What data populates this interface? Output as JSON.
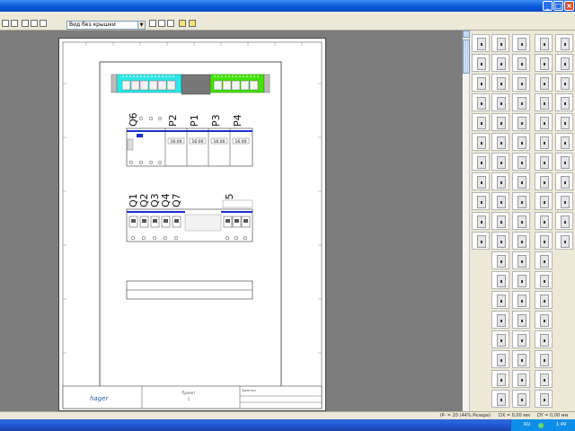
{
  "toolbar": {
    "view_select_value": "Вид без крышки"
  },
  "drawing": {
    "row1_labels": [
      "Q6",
      "P2",
      "P1",
      "P3",
      "P4"
    ],
    "row1_values": [
      "16:00",
      "16:00",
      "16:00",
      "16:00"
    ],
    "row2_labels": [
      "Q1",
      "Q2",
      "Q3",
      "Q4",
      "Q7",
      "Q5"
    ]
  },
  "title_block": {
    "logo": "hager",
    "project_label": "Проект",
    "project_value": "1",
    "notes_label": "Заметки"
  },
  "statusbar": {
    "ip": "IP- = 20 (44% Резерв)",
    "dx": "DX = 0,00 мм",
    "dy": "DY = 0,00 мм"
  },
  "taskbar": {
    "lang": "RU",
    "time": "1:49"
  },
  "colors": {
    "titlebar": "#0a5ad6",
    "busbar_cyan": "#2fe6e6",
    "busbar_green": "#44e300",
    "wire_blue": "#1c2fc8"
  }
}
